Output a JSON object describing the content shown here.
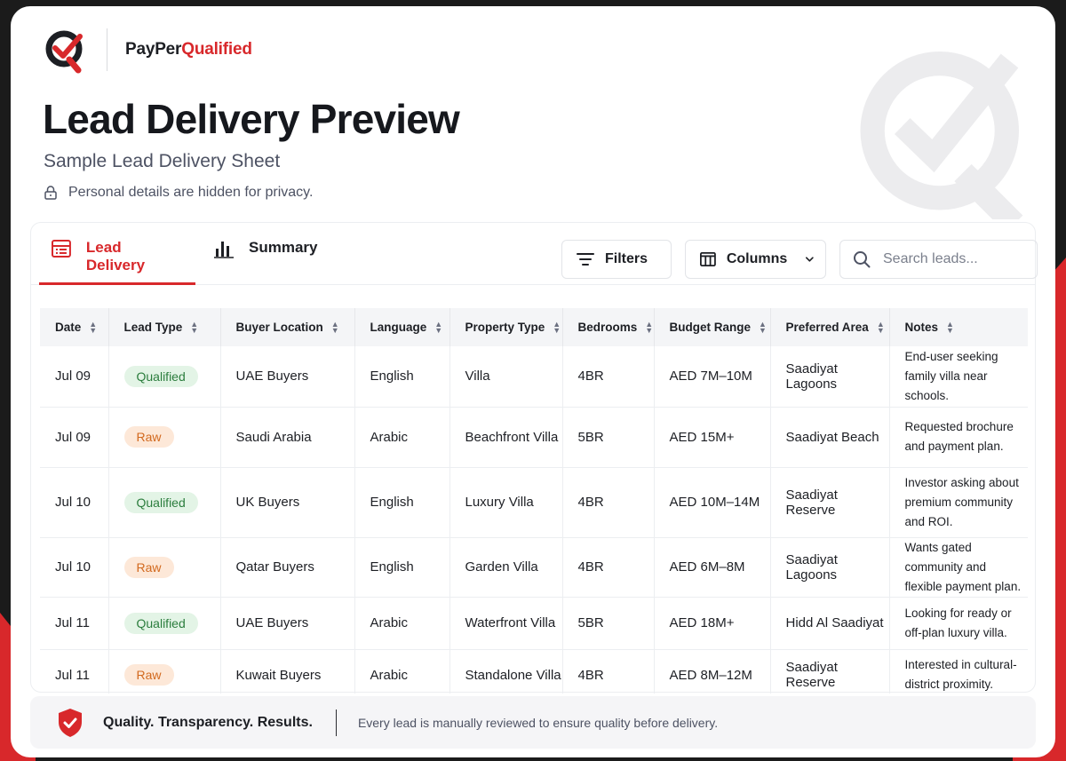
{
  "brand": {
    "prefix": "PayPer",
    "accent": "Qualified"
  },
  "page": {
    "title": "Lead Delivery Preview",
    "subtitle": "Sample Lead Delivery Sheet",
    "privacy_note": "Personal details are hidden for privacy."
  },
  "tabs": [
    {
      "label": "Lead Delivery",
      "icon": "table-icon",
      "active": true
    },
    {
      "label": "Summary",
      "icon": "bar-chart-icon",
      "active": false
    }
  ],
  "toolbar": {
    "filters_label": "Filters",
    "columns_label": "Columns",
    "search_placeholder": "Search leads..."
  },
  "table": {
    "columns": [
      "Date",
      "Lead Type",
      "Buyer Location",
      "Language",
      "Property Type",
      "Bedrooms",
      "Budget Range",
      "Preferred Area",
      "Notes"
    ],
    "rows": [
      {
        "date": "Jul 09",
        "lead_type": "Qualified",
        "location": "UAE Buyers",
        "language": "English",
        "property": "Villa",
        "bedrooms": "4BR",
        "budget": "AED 7M–10M",
        "area": "Saadiyat Lagoons",
        "notes": "End-user seeking family villa near schools."
      },
      {
        "date": "Jul 09",
        "lead_type": "Raw",
        "location": "Saudi Arabia",
        "language": "Arabic",
        "property": "Beachfront Villa",
        "bedrooms": "5BR",
        "budget": "AED 15M+",
        "area": "Saadiyat Beach",
        "notes": "Requested brochure and payment plan."
      },
      {
        "date": "Jul 10",
        "lead_type": "Qualified",
        "location": "UK Buyers",
        "language": "English",
        "property": "Luxury Villa",
        "bedrooms": "4BR",
        "budget": "AED 10M–14M",
        "area": "Saadiyat Reserve",
        "notes": "Investor asking about premium community and ROI."
      },
      {
        "date": "Jul 10",
        "lead_type": "Raw",
        "location": "Qatar Buyers",
        "language": "English",
        "property": "Garden Villa",
        "bedrooms": "4BR",
        "budget": "AED 6M–8M",
        "area": "Saadiyat Lagoons",
        "notes": "Wants gated community and flexible payment plan."
      },
      {
        "date": "Jul 11",
        "lead_type": "Qualified",
        "location": "UAE Buyers",
        "language": "Arabic",
        "property": "Waterfront Villa",
        "bedrooms": "5BR",
        "budget": "AED 18M+",
        "area": "Hidd Al Saadiyat",
        "notes": "Looking for ready or off-plan luxury villa."
      },
      {
        "date": "Jul 11",
        "lead_type": "Raw",
        "location": "Kuwait Buyers",
        "language": "Arabic",
        "property": "Standalone Villa",
        "bedrooms": "4BR",
        "budget": "AED 8M–12M",
        "area": "Saadiyat Reserve",
        "notes": "Interested in cultural-district proximity."
      }
    ]
  },
  "footer": {
    "slogan": "Quality. Transparency. Results.",
    "note": "Every lead is manually reviewed to ensure quality before delivery."
  },
  "colors": {
    "accent": "#d8282b",
    "qualified_bg": "#e3f4e6",
    "qualified_text": "#2b7d3d",
    "raw_bg": "#fde8d8",
    "raw_text": "#d2691e"
  }
}
